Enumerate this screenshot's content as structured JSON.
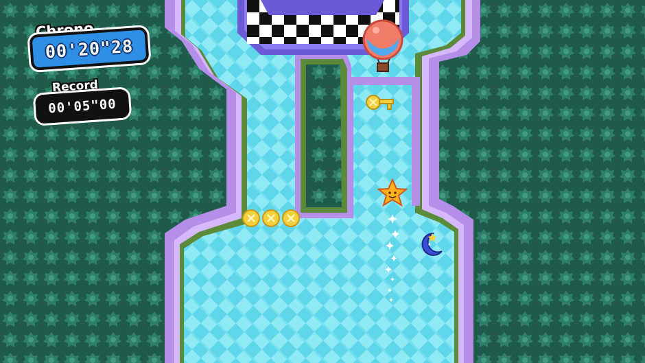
{
  "hud": {
    "chrono_label": "Chrono",
    "chrono_time": "00'20\"28",
    "record_label": "Record",
    "record_time": "00'05\"00"
  },
  "colors": {
    "forest_dark": "#1f5a4a",
    "bush": "#2f7f68",
    "bush_light": "#3f9a80",
    "water": "#5fd6ea",
    "water_light": "#8fe9f4",
    "shore": "#b48ee8",
    "shore_light": "#d6b8ff",
    "grass_edge": "#5a8a3a",
    "goal_purple": "#7a6ae6",
    "coin": "#f4cf3c",
    "balloon": "#f27c6a",
    "star": "#ffb21c",
    "moon": "#3b4fd6"
  },
  "entities": [
    {
      "kind": "goal-checkered-platform"
    },
    {
      "kind": "hot-air-balloon"
    },
    {
      "kind": "key"
    },
    {
      "kind": "coin",
      "count": 3
    },
    {
      "kind": "star-player"
    },
    {
      "kind": "moon-enemy"
    }
  ]
}
